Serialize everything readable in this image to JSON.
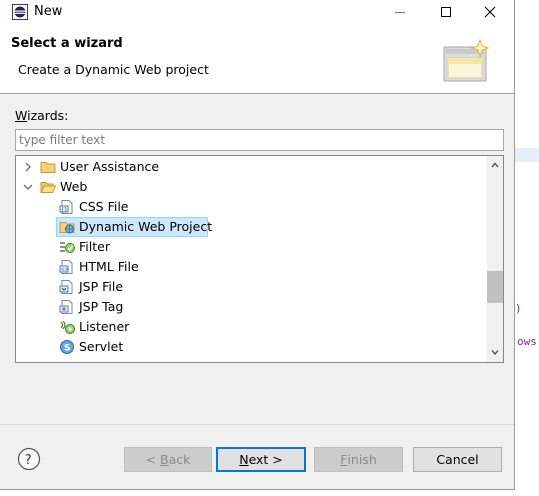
{
  "window": {
    "title": "New",
    "minimize_glyph": "—",
    "maximize_glyph": "☐",
    "close_glyph": "✕"
  },
  "header": {
    "title": "Select a wizard",
    "description": "Create a Dynamic Web project",
    "banner_icon": "new-wizard-banner-icon"
  },
  "wizards": {
    "label_mnemonic": "W",
    "label_rest": "izards:",
    "filter_placeholder": "type filter text",
    "filter_value": ""
  },
  "tree": {
    "items": [
      {
        "label": "User Assistance",
        "icon": "folder-icon",
        "twisty": "collapsed",
        "level": 0
      },
      {
        "label": "Web",
        "icon": "folder-open-icon",
        "twisty": "expanded",
        "level": 0
      },
      {
        "label": "CSS File",
        "icon": "css-file-icon",
        "level": 1
      },
      {
        "label": "Dynamic Web Project",
        "icon": "dynamic-web-project-icon",
        "level": 1,
        "selected": true
      },
      {
        "label": "Filter",
        "icon": "filter-icon",
        "level": 1
      },
      {
        "label": "HTML File",
        "icon": "html-file-icon",
        "level": 1
      },
      {
        "label": "JSP File",
        "icon": "jsp-file-icon",
        "level": 1
      },
      {
        "label": "JSP Tag",
        "icon": "jsp-tag-icon",
        "level": 1
      },
      {
        "label": "Listener",
        "icon": "listener-icon",
        "level": 1
      },
      {
        "label": "Servlet",
        "icon": "servlet-icon",
        "level": 1
      }
    ]
  },
  "buttons": {
    "back": {
      "prefix": "< ",
      "mnemonic": "B",
      "rest": "ack",
      "enabled": false
    },
    "next": {
      "mnemonic": "N",
      "rest": "ext >",
      "enabled": true,
      "default": true
    },
    "finish": {
      "mnemonic": "F",
      "rest": "inish",
      "enabled": false
    },
    "cancel": {
      "label": "Cancel",
      "enabled": true
    }
  },
  "background_ide": {
    "fragment_text": "ows",
    "paren_text": ")"
  },
  "colors": {
    "selection_bg": "#cce8ff",
    "selection_border": "#99d1ff",
    "default_button_border": "#0078d7",
    "folder_yellow": "#e8b84a"
  }
}
